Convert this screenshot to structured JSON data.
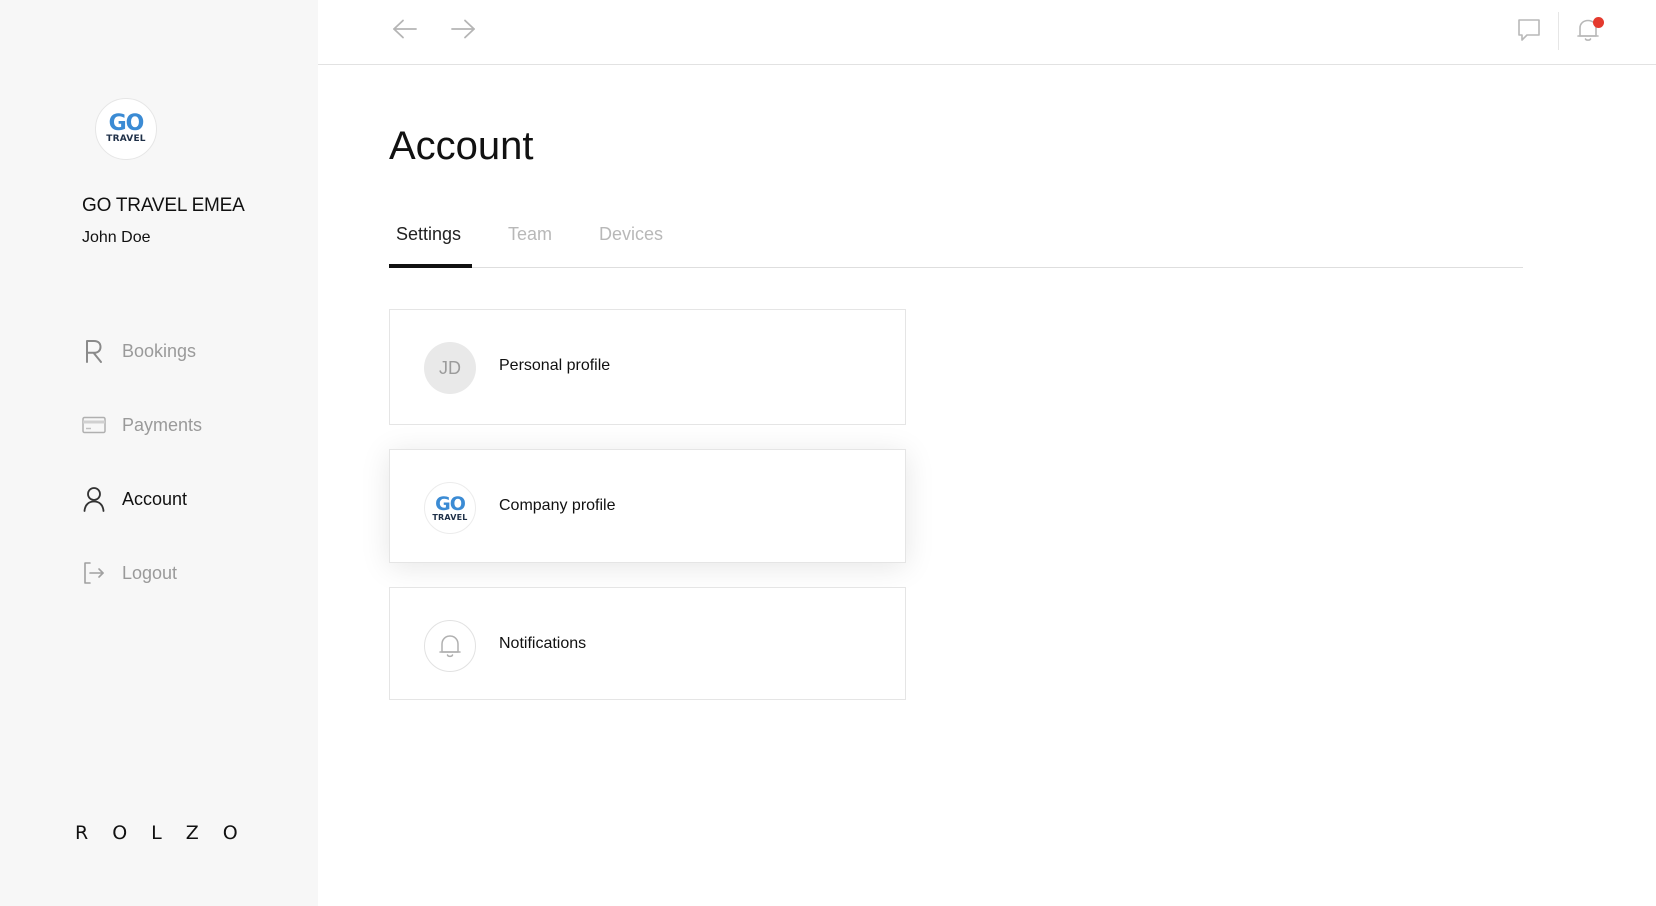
{
  "sidebar": {
    "company_logo": {
      "go": "GO",
      "travel": "TRAVEL"
    },
    "company_name": "GO TRAVEL EMEA",
    "user_name": "John Doe",
    "items": [
      {
        "label": "Bookings",
        "icon": "r-letter-icon",
        "active": false
      },
      {
        "label": "Payments",
        "icon": "credit-card-icon",
        "active": false
      },
      {
        "label": "Account",
        "icon": "user-icon",
        "active": true
      },
      {
        "label": "Logout",
        "icon": "logout-icon",
        "active": false
      }
    ],
    "brand": "ROLZO"
  },
  "topbar": {
    "back_icon": "arrow-left-icon",
    "forward_icon": "arrow-right-icon",
    "chat_icon": "chat-icon",
    "notifications_icon": "bell-icon",
    "has_unread_notifications": true
  },
  "main": {
    "title": "Account",
    "tabs": [
      {
        "label": "Settings",
        "active": true
      },
      {
        "label": "Team",
        "active": false
      },
      {
        "label": "Devices",
        "active": false
      }
    ],
    "cards": [
      {
        "label": "Personal profile",
        "avatar_initials": "JD"
      },
      {
        "label": "Company profile",
        "avatar_logo": {
          "go": "GO",
          "travel": "TRAVEL"
        }
      },
      {
        "label": "Notifications",
        "icon": "bell-icon"
      }
    ]
  },
  "colors": {
    "sidebar_bg": "#f7f7f7",
    "brand_blue": "#3b8bd4",
    "notification_dot": "#e43a2e",
    "inactive_text": "#9a9a9a",
    "active_text": "#111111"
  }
}
